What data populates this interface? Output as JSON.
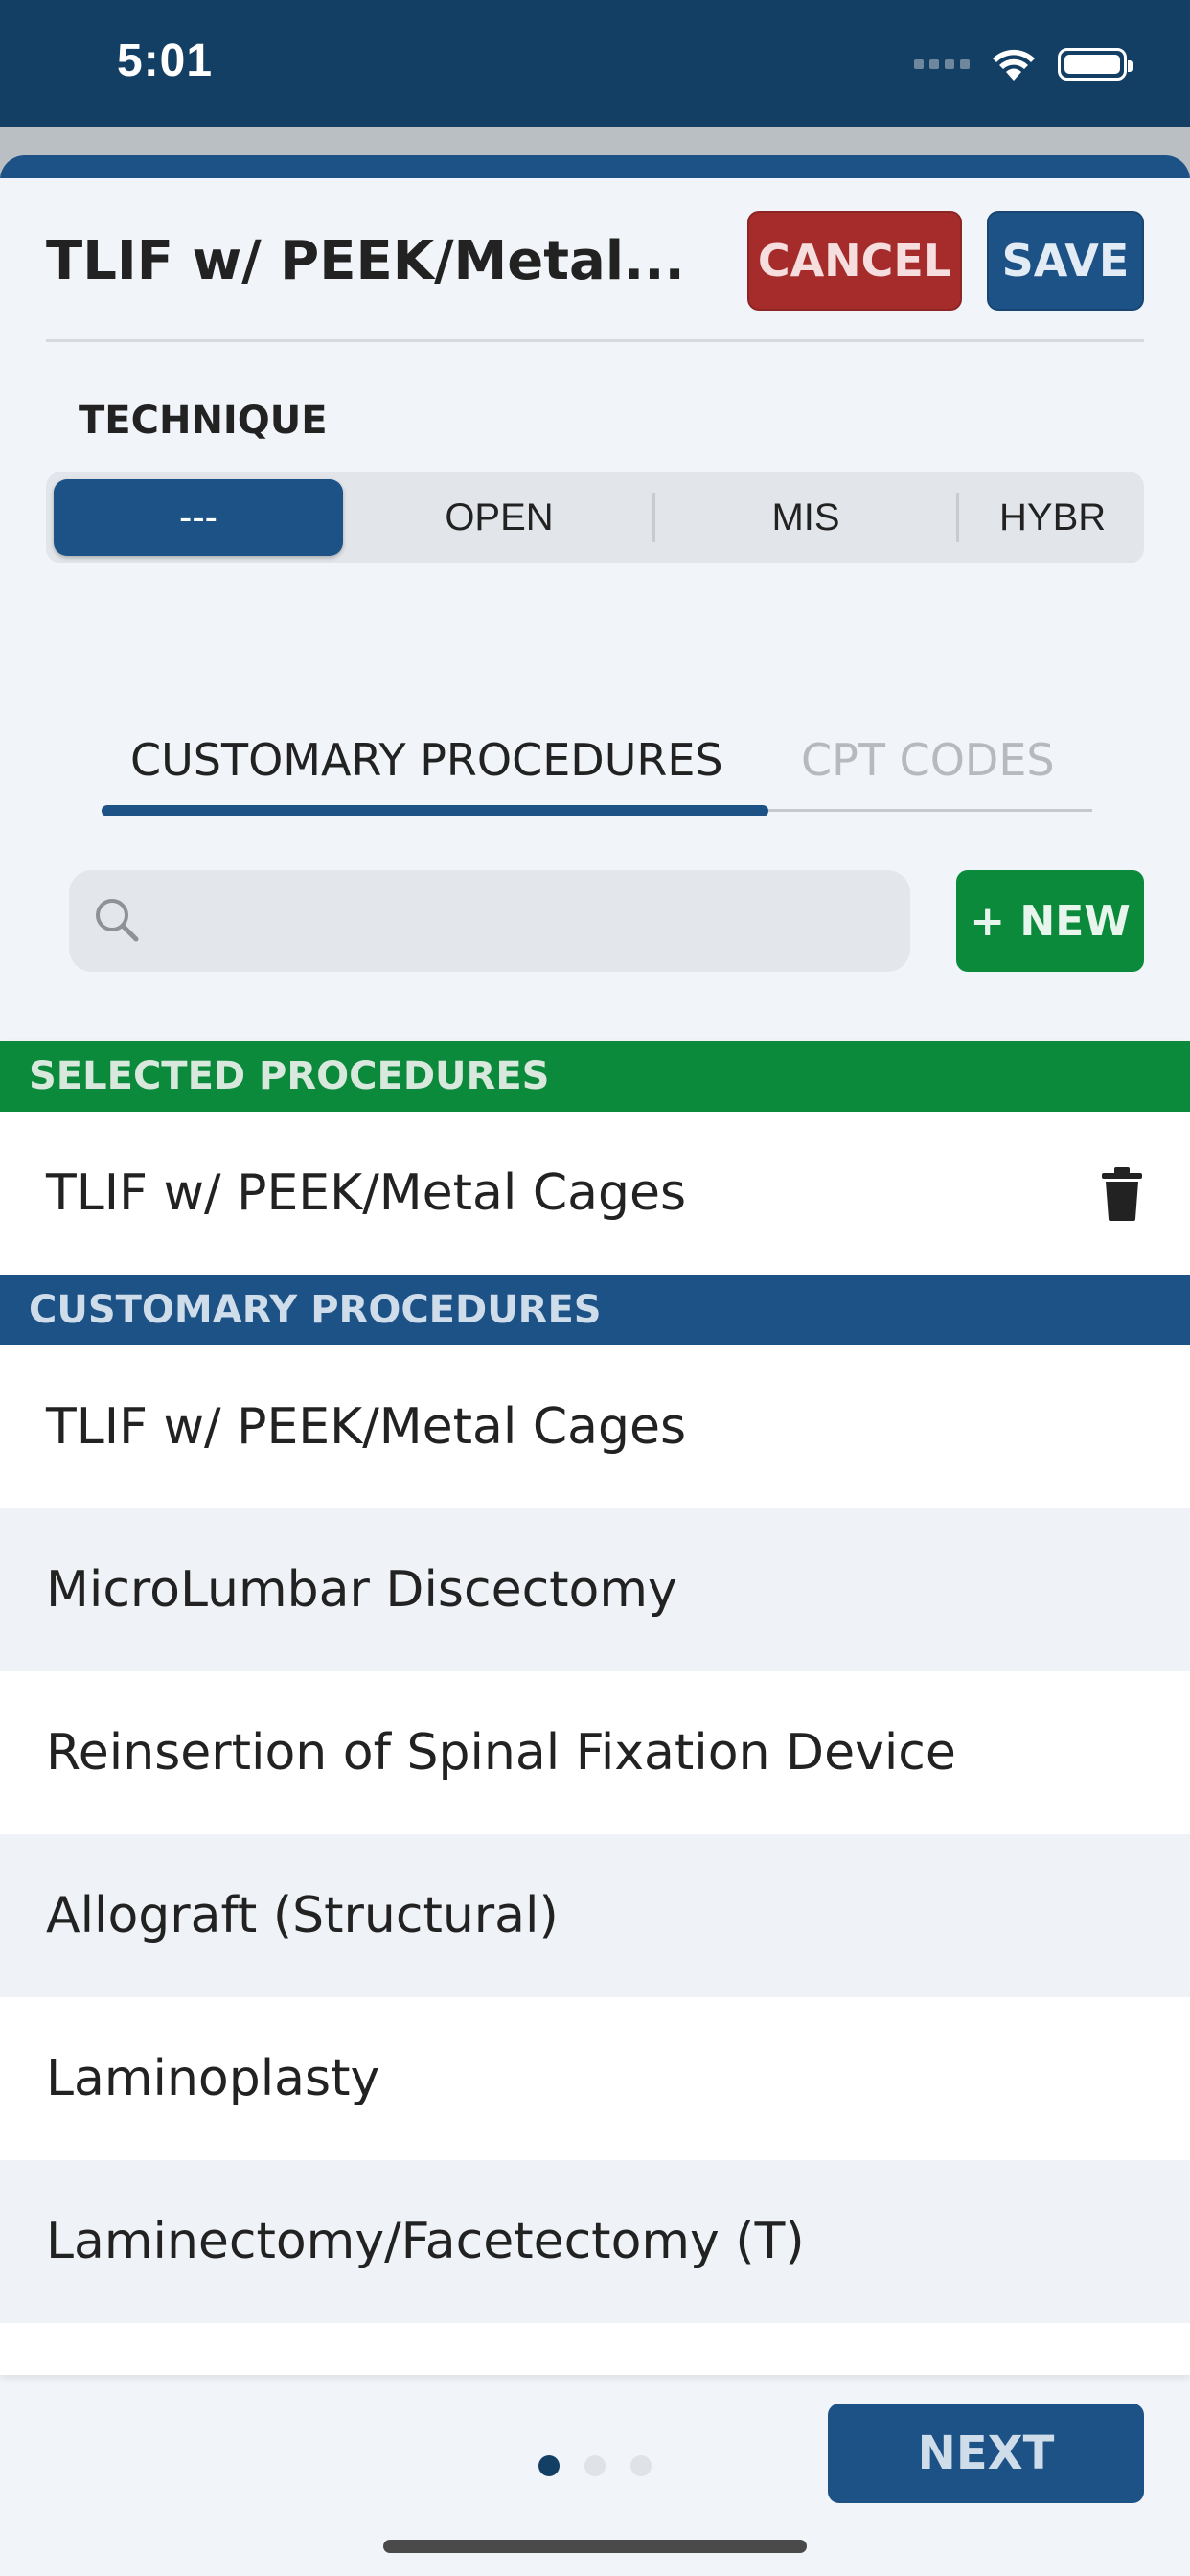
{
  "status_bar": {
    "time": "5:01"
  },
  "header": {
    "title": "TLIF w/ PEEK/Metal...",
    "cancel_label": "CANCEL",
    "save_label": "SAVE"
  },
  "technique": {
    "label": "TECHNIQUE",
    "options": [
      "---",
      "OPEN",
      "MIS",
      "HYBR"
    ],
    "selected": "---"
  },
  "tabs": [
    {
      "label": "CUSTOMARY PROCEDURES",
      "active": true
    },
    {
      "label": "CPT CODES",
      "active": false
    }
  ],
  "search": {
    "placeholder": "",
    "value": ""
  },
  "new_button_label": "+ NEW",
  "selected_section": {
    "header": "SELECTED PROCEDURES",
    "items": [
      "TLIF w/ PEEK/Metal Cages"
    ]
  },
  "customary_section": {
    "header": "CUSTOMARY PROCEDURES",
    "items": [
      "TLIF w/ PEEK/Metal Cages",
      "MicroLumbar Discectomy",
      "Reinsertion of Spinal Fixation Device",
      "Allograft (Structural)",
      "Laminoplasty",
      "Laminectomy/Facetectomy (T)"
    ]
  },
  "pagination": {
    "current_page": 1,
    "total_pages": 3
  },
  "next_label": "NEXT",
  "colors": {
    "primary": "#1d5286",
    "status_bar": "#143f64",
    "cancel": "#a62c2c",
    "success": "#0a8a3a"
  },
  "icons": [
    "search-icon",
    "trash-icon",
    "wifi-icon",
    "battery-icon"
  ]
}
